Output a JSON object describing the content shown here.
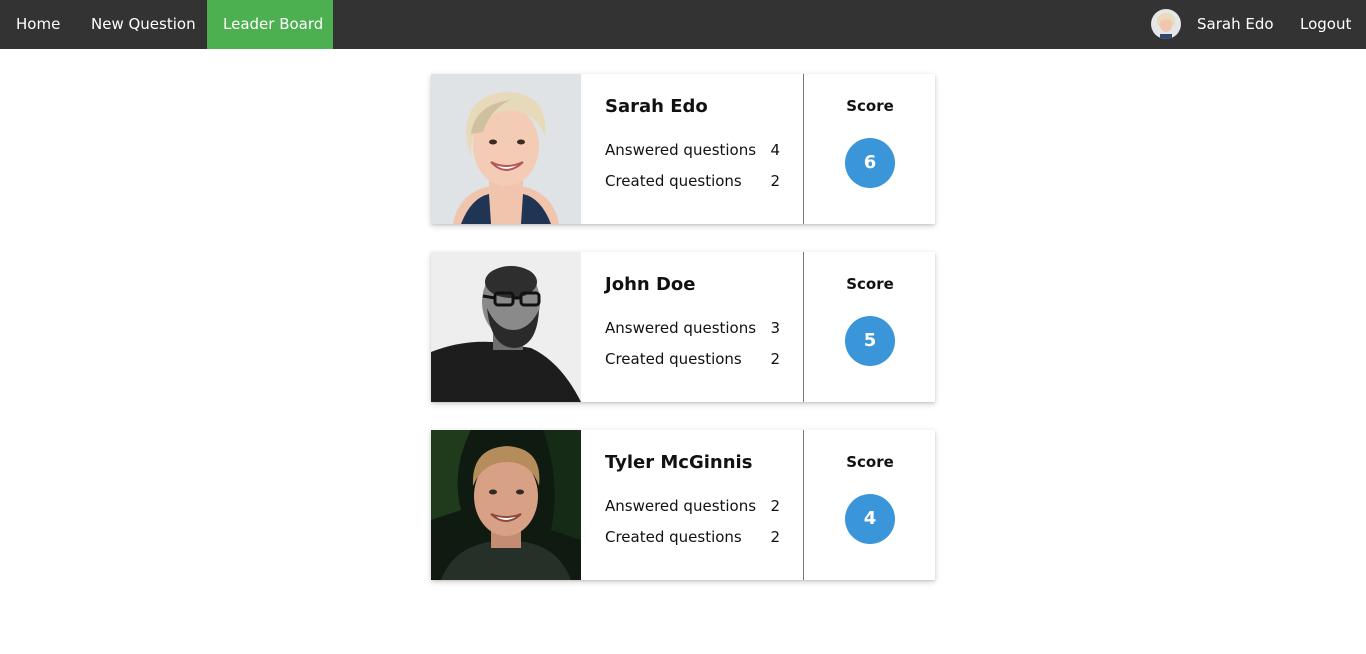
{
  "nav": {
    "home": "Home",
    "new_question": "New Question",
    "leader_board": "Leader Board",
    "user_name": "Sarah Edo",
    "logout": "Logout",
    "active_color": "#4caf50",
    "bar_color": "#333333"
  },
  "leaderboard": [
    {
      "name": "Sarah Edo",
      "answered_label": "Answered questions",
      "answered": "4",
      "created_label": "Created questions",
      "created": "2",
      "score_label": "Score",
      "score": "6"
    },
    {
      "name": "John Doe",
      "answered_label": "Answered questions",
      "answered": "3",
      "created_label": "Created questions",
      "created": "2",
      "score_label": "Score",
      "score": "5"
    },
    {
      "name": "Tyler McGinnis",
      "answered_label": "Answered questions",
      "answered": "2",
      "created_label": "Created questions",
      "created": "2",
      "score_label": "Score",
      "score": "4"
    }
  ],
  "score_color": "#3a96d8"
}
